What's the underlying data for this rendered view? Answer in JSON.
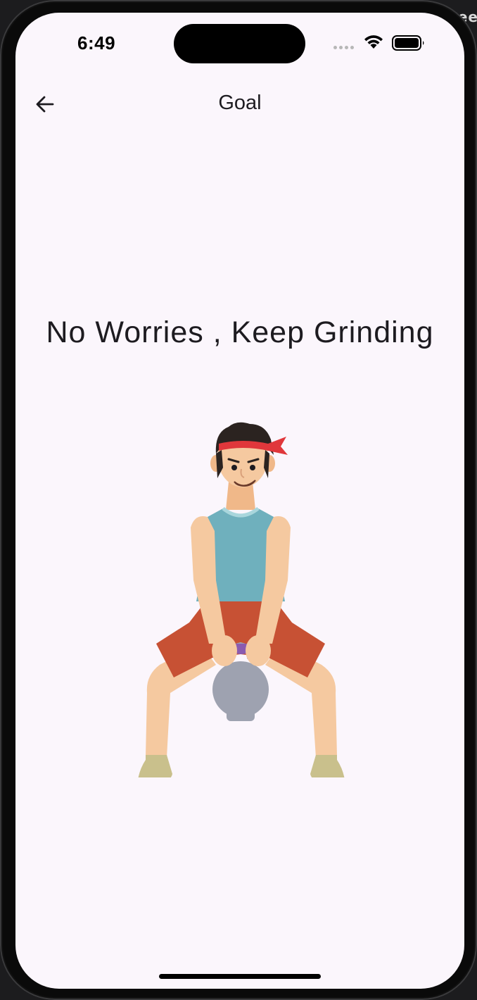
{
  "status_bar": {
    "time": "6:49"
  },
  "backdrop": {
    "corner_text": "ree"
  },
  "app_bar": {
    "title": "Goal",
    "back_icon": "arrow-left-icon"
  },
  "content": {
    "message": "No Worries , Keep Grinding",
    "illustration": "kettlebell-workout-man-illustration"
  },
  "colors": {
    "screen_background": "#fbf6fc",
    "text": "#1d1b20",
    "headband": "#e0373b",
    "tank_top": "#6fb0bd",
    "shorts": "#c75134",
    "skin": "#f5c9a0",
    "kettlebell": "#9ea2b0"
  }
}
